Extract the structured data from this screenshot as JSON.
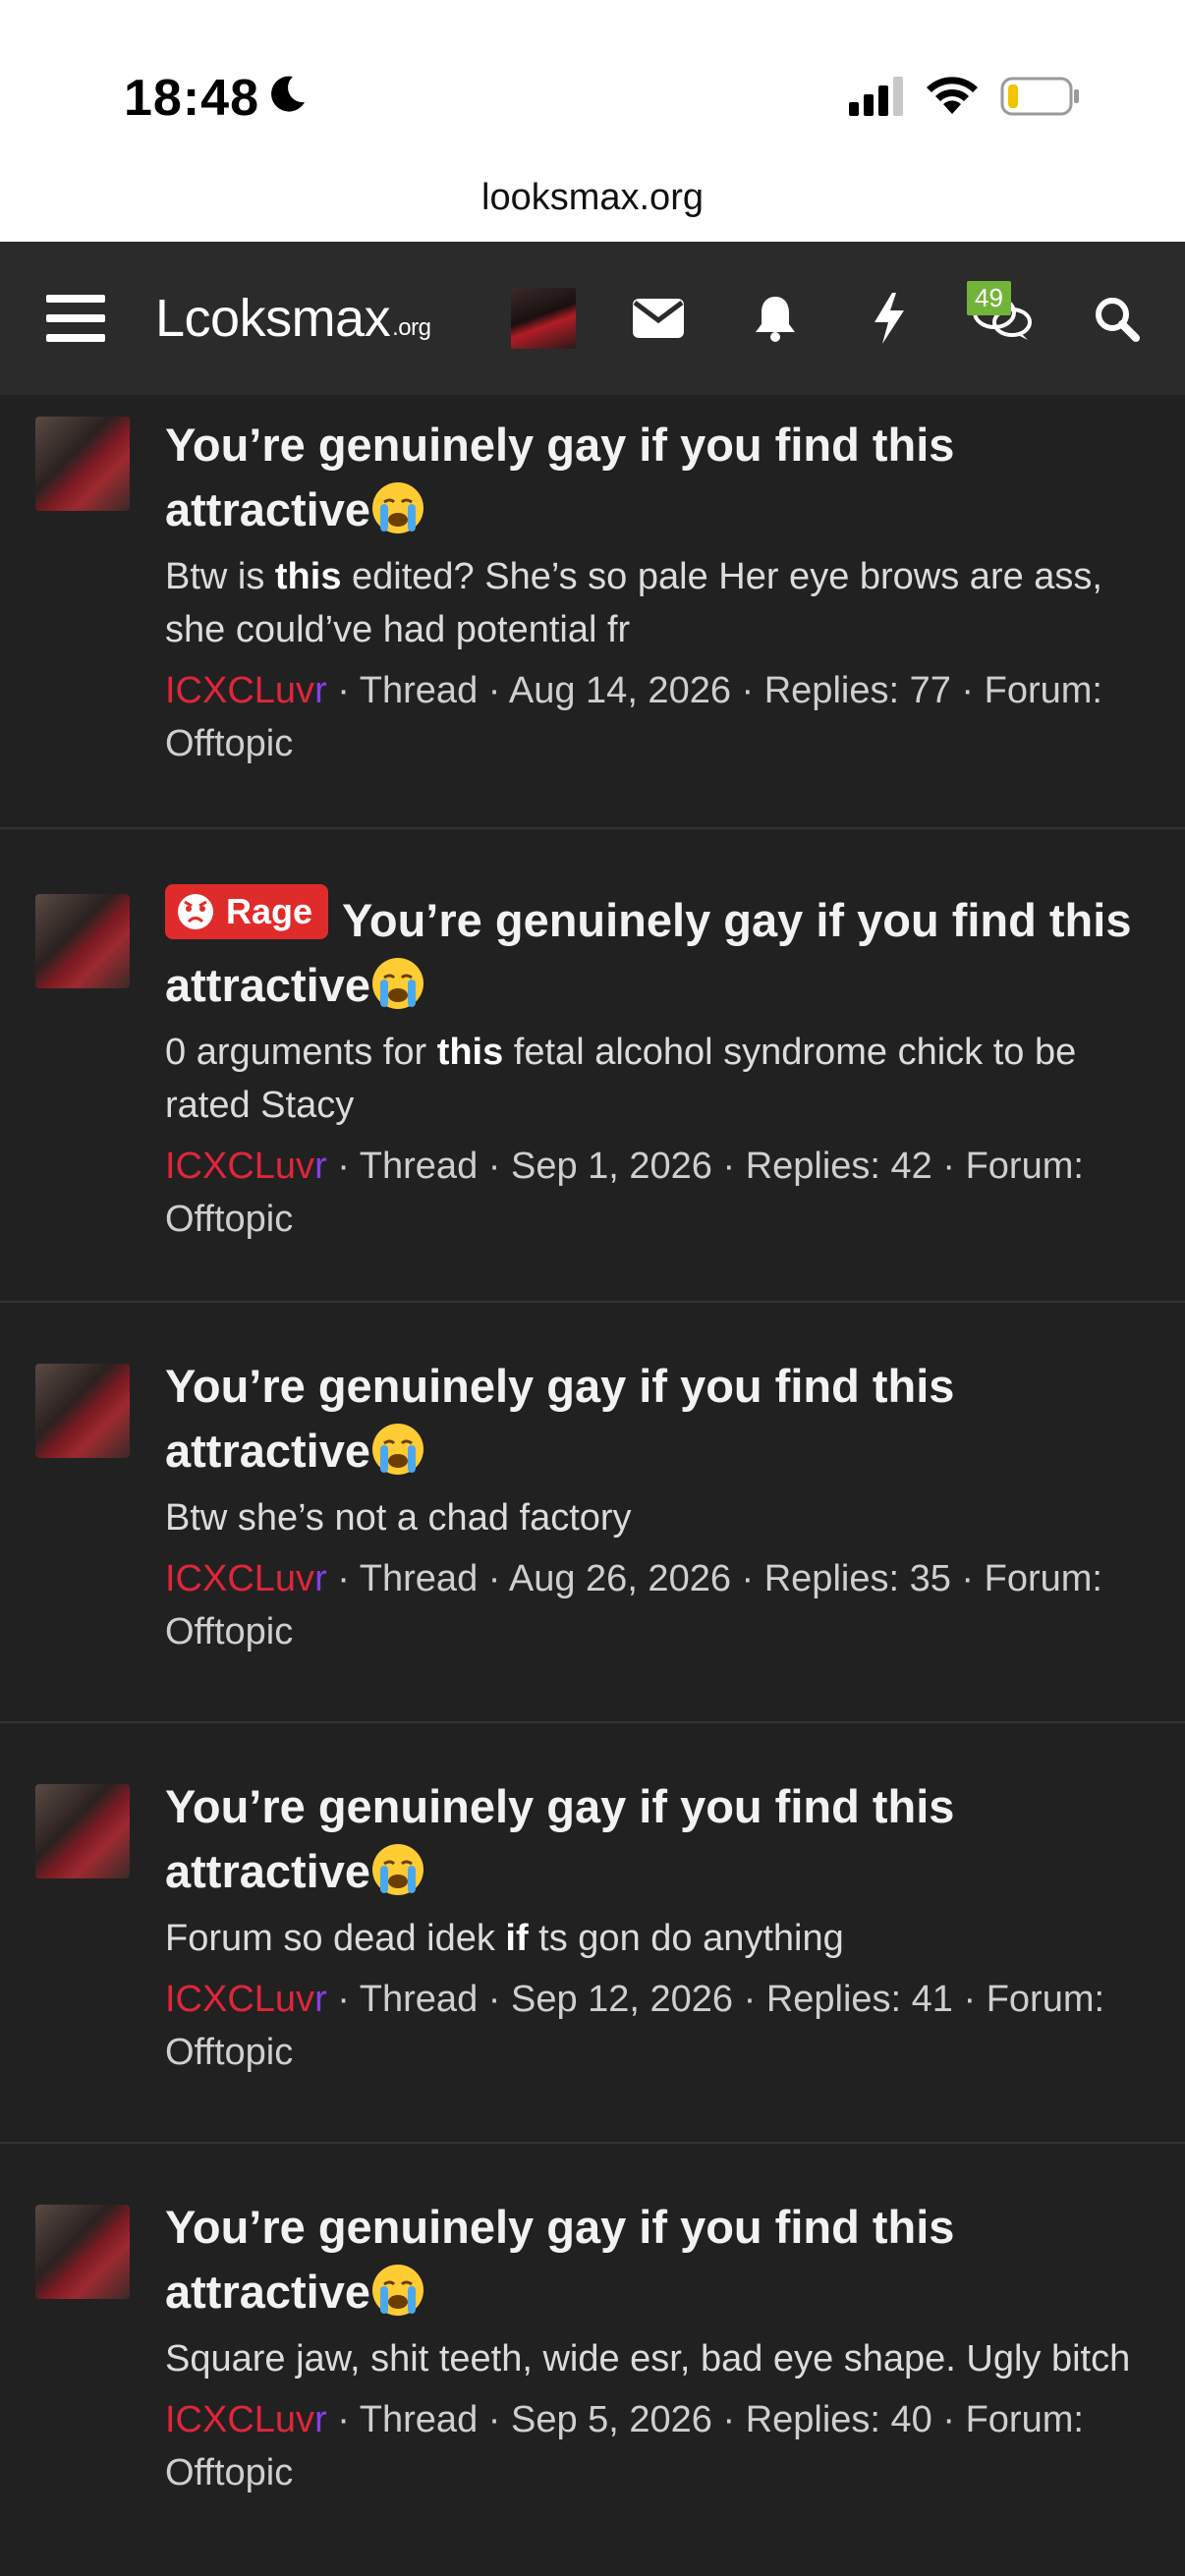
{
  "status_bar": {
    "time": "18:48",
    "moon_icon": "moon-icon",
    "signal_icon": "signal-icon",
    "wifi_icon": "wifi-icon",
    "battery_icon": "battery-low-icon"
  },
  "browser": {
    "url": "looksmax.org"
  },
  "nav": {
    "logo_main": "Lcoksmax",
    "logo_suffix": ".org",
    "chat_badge": "49",
    "icons": [
      "menu-icon",
      "avatar",
      "mail-icon",
      "bell-icon",
      "bolt-icon",
      "chat-icon",
      "search-icon"
    ]
  },
  "threads": [
    {
      "prefix": "",
      "title": "You’re genuinely gay if you find this attractive",
      "snippet_before": "Btw is ",
      "snippet_bold": "this",
      "snippet_after": " edited? She’s so pale Her eye brows are ass, she could’ve had potential fr",
      "user_main": "ICXCLuv",
      "user_tail": "r",
      "meta": " · Thread · Aug 14, 2026 · Replies: 77 · Forum: Offtopic"
    },
    {
      "prefix": "Rage",
      "title": "You’re genuinely gay if you find this attractive",
      "snippet_before": "0 arguments for ",
      "snippet_bold": "this",
      "snippet_after": " fetal alcohol syndrome chick to be rated Stacy",
      "user_main": "ICXCLuv",
      "user_tail": "r",
      "meta": " · Thread · Sep 1, 2026 · Replies: 42 · Forum: Offtopic"
    },
    {
      "prefix": "",
      "title": "You’re genuinely gay if you find this attractive",
      "snippet_before": "Btw she’s not a chad factory",
      "snippet_bold": "",
      "snippet_after": "",
      "user_main": "ICXCLuv",
      "user_tail": "r",
      "meta": " · Thread · Aug 26, 2026 · Replies: 35 · Forum: Offtopic"
    },
    {
      "prefix": "",
      "title": "You’re genuinely gay if you find this attractive",
      "snippet_before": "Forum so dead idek ",
      "snippet_bold": "if",
      "snippet_after": " ts gon do anything",
      "user_main": "ICXCLuv",
      "user_tail": "r",
      "meta": " · Thread · Sep 12, 2026 · Replies: 41 · Forum: Offtopic"
    },
    {
      "prefix": "",
      "title": "You’re genuinely gay if you find this attractive",
      "snippet_before": "Square jaw, shit teeth, wide esr, bad eye shape. Ugly bitch",
      "snippet_bold": "",
      "snippet_after": "",
      "user_main": "ICXCLuv",
      "user_tail": "r",
      "meta": " · Thread · Sep 5, 2026 · Replies: 40 · Forum: Offtopic"
    }
  ]
}
